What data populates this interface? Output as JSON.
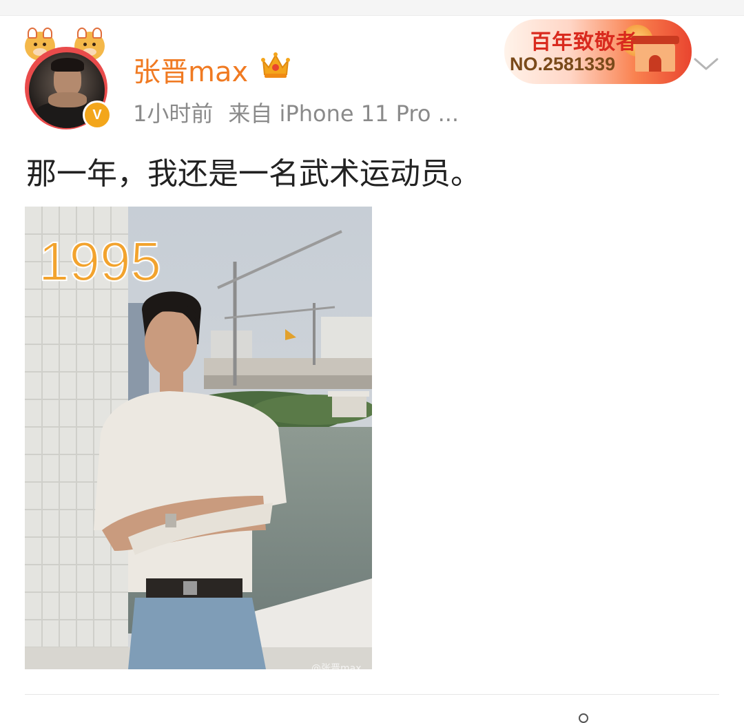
{
  "post": {
    "username": "张晋max",
    "time": "1小时前",
    "source": "来自 iPhone 11 Pro ...",
    "badge_title": "百年致敬者",
    "badge_number": "NO.2581339",
    "text": "那一年，我还是一名武术运动员。",
    "photo_year": "1995",
    "watermark": "@张晋max"
  },
  "icons": {
    "avatar": "user-avatar",
    "verified": "verified-v-icon",
    "crown": "crown-icon",
    "more": "chevron-down-icon"
  },
  "colors": {
    "username": "#f07a22",
    "verified": "#f3a61b",
    "meta": "#8a8a8a",
    "text": "#222222",
    "year": "#f2a32e"
  }
}
